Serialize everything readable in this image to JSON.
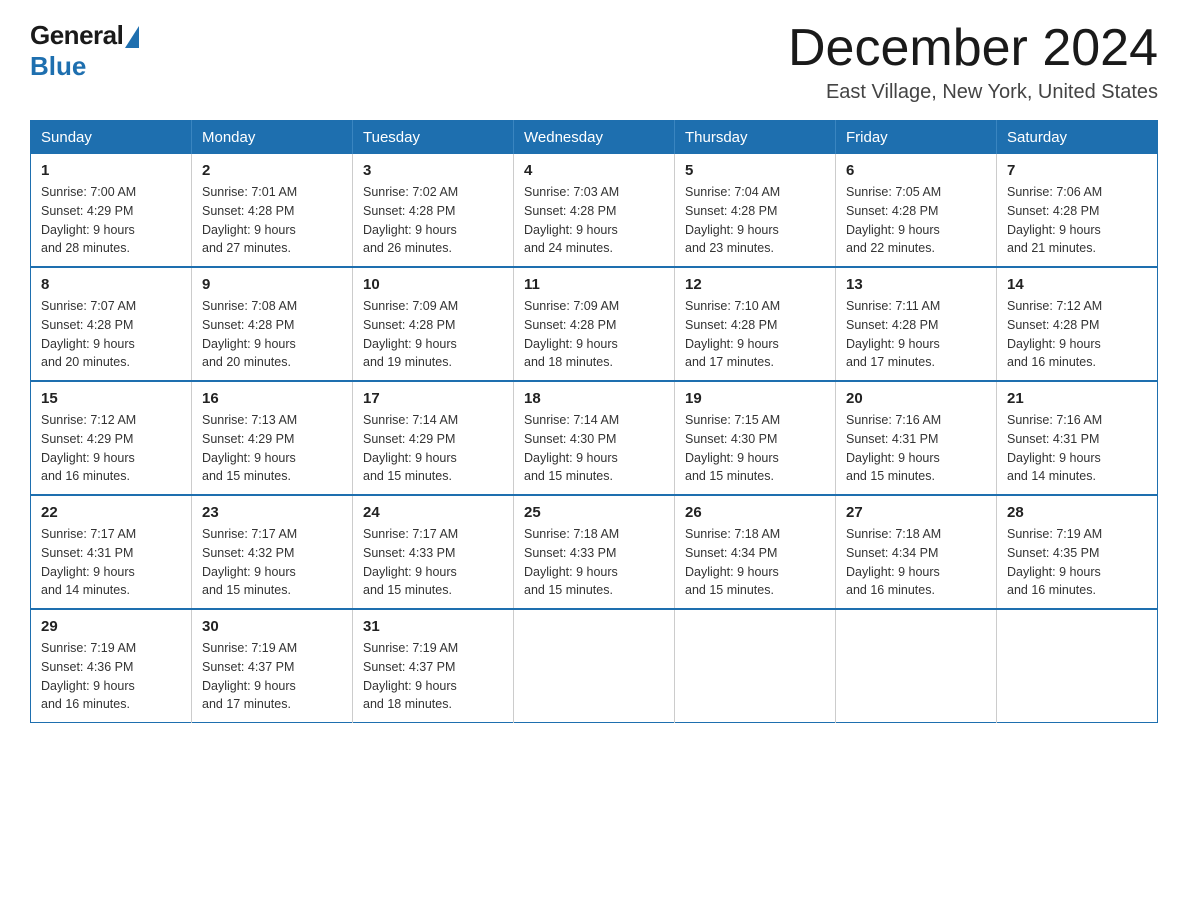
{
  "logo": {
    "general": "General",
    "blue": "Blue"
  },
  "title": {
    "month": "December 2024",
    "location": "East Village, New York, United States"
  },
  "days_of_week": [
    "Sunday",
    "Monday",
    "Tuesday",
    "Wednesday",
    "Thursday",
    "Friday",
    "Saturday"
  ],
  "weeks": [
    [
      {
        "day": "1",
        "sunrise": "7:00 AM",
        "sunset": "4:29 PM",
        "daylight": "9 hours and 28 minutes."
      },
      {
        "day": "2",
        "sunrise": "7:01 AM",
        "sunset": "4:28 PM",
        "daylight": "9 hours and 27 minutes."
      },
      {
        "day": "3",
        "sunrise": "7:02 AM",
        "sunset": "4:28 PM",
        "daylight": "9 hours and 26 minutes."
      },
      {
        "day": "4",
        "sunrise": "7:03 AM",
        "sunset": "4:28 PM",
        "daylight": "9 hours and 24 minutes."
      },
      {
        "day": "5",
        "sunrise": "7:04 AM",
        "sunset": "4:28 PM",
        "daylight": "9 hours and 23 minutes."
      },
      {
        "day": "6",
        "sunrise": "7:05 AM",
        "sunset": "4:28 PM",
        "daylight": "9 hours and 22 minutes."
      },
      {
        "day": "7",
        "sunrise": "7:06 AM",
        "sunset": "4:28 PM",
        "daylight": "9 hours and 21 minutes."
      }
    ],
    [
      {
        "day": "8",
        "sunrise": "7:07 AM",
        "sunset": "4:28 PM",
        "daylight": "9 hours and 20 minutes."
      },
      {
        "day": "9",
        "sunrise": "7:08 AM",
        "sunset": "4:28 PM",
        "daylight": "9 hours and 20 minutes."
      },
      {
        "day": "10",
        "sunrise": "7:09 AM",
        "sunset": "4:28 PM",
        "daylight": "9 hours and 19 minutes."
      },
      {
        "day": "11",
        "sunrise": "7:09 AM",
        "sunset": "4:28 PM",
        "daylight": "9 hours and 18 minutes."
      },
      {
        "day": "12",
        "sunrise": "7:10 AM",
        "sunset": "4:28 PM",
        "daylight": "9 hours and 17 minutes."
      },
      {
        "day": "13",
        "sunrise": "7:11 AM",
        "sunset": "4:28 PM",
        "daylight": "9 hours and 17 minutes."
      },
      {
        "day": "14",
        "sunrise": "7:12 AM",
        "sunset": "4:28 PM",
        "daylight": "9 hours and 16 minutes."
      }
    ],
    [
      {
        "day": "15",
        "sunrise": "7:12 AM",
        "sunset": "4:29 PM",
        "daylight": "9 hours and 16 minutes."
      },
      {
        "day": "16",
        "sunrise": "7:13 AM",
        "sunset": "4:29 PM",
        "daylight": "9 hours and 15 minutes."
      },
      {
        "day": "17",
        "sunrise": "7:14 AM",
        "sunset": "4:29 PM",
        "daylight": "9 hours and 15 minutes."
      },
      {
        "day": "18",
        "sunrise": "7:14 AM",
        "sunset": "4:30 PM",
        "daylight": "9 hours and 15 minutes."
      },
      {
        "day": "19",
        "sunrise": "7:15 AM",
        "sunset": "4:30 PM",
        "daylight": "9 hours and 15 minutes."
      },
      {
        "day": "20",
        "sunrise": "7:16 AM",
        "sunset": "4:31 PM",
        "daylight": "9 hours and 15 minutes."
      },
      {
        "day": "21",
        "sunrise": "7:16 AM",
        "sunset": "4:31 PM",
        "daylight": "9 hours and 14 minutes."
      }
    ],
    [
      {
        "day": "22",
        "sunrise": "7:17 AM",
        "sunset": "4:31 PM",
        "daylight": "9 hours and 14 minutes."
      },
      {
        "day": "23",
        "sunrise": "7:17 AM",
        "sunset": "4:32 PM",
        "daylight": "9 hours and 15 minutes."
      },
      {
        "day": "24",
        "sunrise": "7:17 AM",
        "sunset": "4:33 PM",
        "daylight": "9 hours and 15 minutes."
      },
      {
        "day": "25",
        "sunrise": "7:18 AM",
        "sunset": "4:33 PM",
        "daylight": "9 hours and 15 minutes."
      },
      {
        "day": "26",
        "sunrise": "7:18 AM",
        "sunset": "4:34 PM",
        "daylight": "9 hours and 15 minutes."
      },
      {
        "day": "27",
        "sunrise": "7:18 AM",
        "sunset": "4:34 PM",
        "daylight": "9 hours and 16 minutes."
      },
      {
        "day": "28",
        "sunrise": "7:19 AM",
        "sunset": "4:35 PM",
        "daylight": "9 hours and 16 minutes."
      }
    ],
    [
      {
        "day": "29",
        "sunrise": "7:19 AM",
        "sunset": "4:36 PM",
        "daylight": "9 hours and 16 minutes."
      },
      {
        "day": "30",
        "sunrise": "7:19 AM",
        "sunset": "4:37 PM",
        "daylight": "9 hours and 17 minutes."
      },
      {
        "day": "31",
        "sunrise": "7:19 AM",
        "sunset": "4:37 PM",
        "daylight": "9 hours and 18 minutes."
      },
      null,
      null,
      null,
      null
    ]
  ],
  "labels": {
    "sunrise": "Sunrise: ",
    "sunset": "Sunset: ",
    "daylight": "Daylight: "
  }
}
